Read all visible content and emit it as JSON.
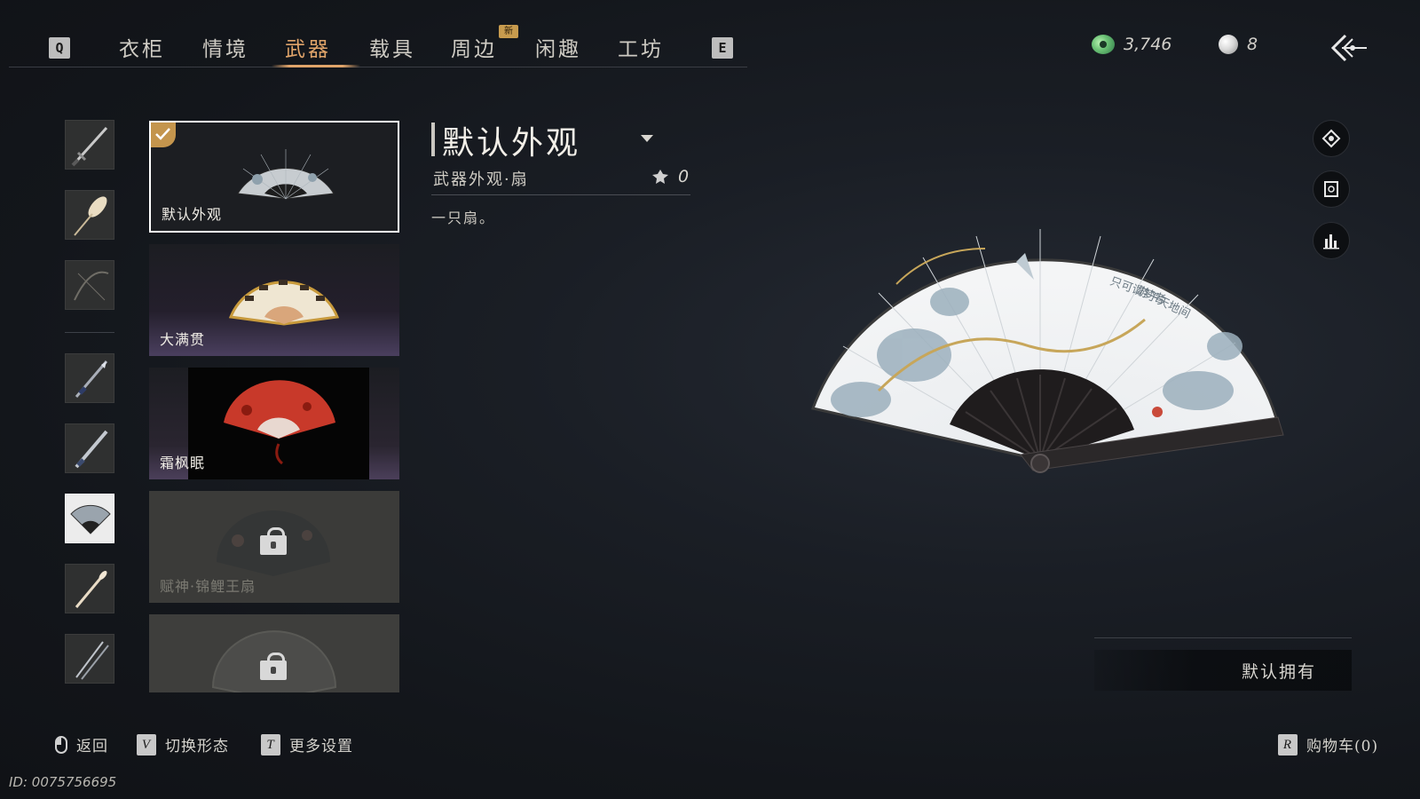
{
  "tabs": {
    "prev_key": "Q",
    "next_key": "E",
    "items": [
      {
        "label": "衣柜"
      },
      {
        "label": "情境"
      },
      {
        "label": "武器"
      },
      {
        "label": "载具"
      },
      {
        "label": "周边",
        "badge": "新"
      },
      {
        "label": "闲趣"
      },
      {
        "label": "工坊"
      }
    ],
    "active_index": 2
  },
  "currency": {
    "jade_amount": "3,746",
    "pearl_amount": "8"
  },
  "cards": [
    {
      "label": "默认外观",
      "selected": true
    },
    {
      "label": "大满贯"
    },
    {
      "label": "霜枫眠"
    },
    {
      "label": "赋神·锦鲤王扇",
      "locked": true
    },
    {
      "label": "",
      "locked": true
    }
  ],
  "detail": {
    "title": "默认外观",
    "subtitle": "武器外观·扇",
    "count": "0",
    "description": "一只扇。"
  },
  "ownership": {
    "text": "默认拥有"
  },
  "hints": {
    "back": {
      "key": "mouse",
      "label": "返回"
    },
    "switch_form": {
      "key": "V",
      "label": "切换形态"
    },
    "more_settings": {
      "key": "T",
      "label": "更多设置"
    },
    "cart": {
      "key": "R",
      "label": "购物车(0)"
    }
  },
  "player_id": "ID: 0075756695",
  "colors": {
    "accent": "#e0a46a",
    "background": "#15181d",
    "card_selected_border": "#ffffff"
  }
}
